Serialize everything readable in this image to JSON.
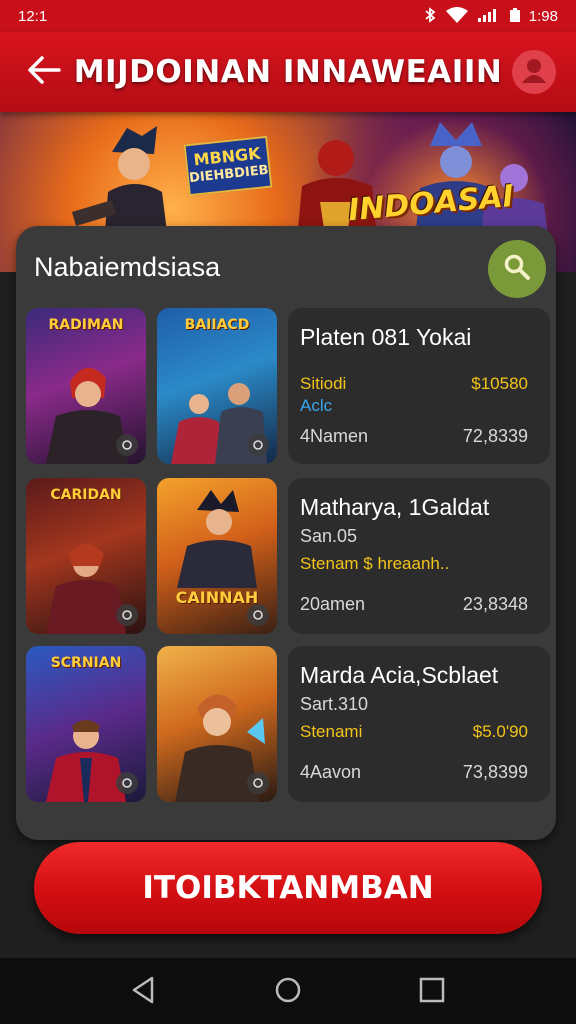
{
  "status_bar": {
    "time": "12:1",
    "battery_text": "1:98"
  },
  "app_bar": {
    "title": "MIJDOINAN INNAWEAIIN",
    "back_icon": "arrow-left-icon",
    "profile_icon": "user-avatar-icon"
  },
  "banner": {
    "logo_line1": "MBNGK",
    "logo_line2": "DIEHBDIEB",
    "headline": "INDOASAI"
  },
  "search": {
    "text": "Nabaiemdsiasa",
    "icon": "search-icon"
  },
  "games": [
    {
      "thumb1_title": "RADIMAN",
      "thumb2_title": "BAIIACD",
      "name": "Platen 081 Yokai",
      "sub": "",
      "label1": "Sitiodi",
      "label2": "Aclc",
      "price": "$10580",
      "meta_left": "4Namen",
      "meta_right": "72,8339"
    },
    {
      "thumb1_title": "CARIDAN",
      "thumb2_title": "CAINNAH",
      "name": "Matharya, 1Galdat",
      "sub": "San.05",
      "label1": "Stenam $ hreaanh..",
      "label2": "",
      "price": "",
      "meta_left": "20amen",
      "meta_right": "23,8348"
    },
    {
      "thumb1_title": "SCRNIAN",
      "thumb2_title": "",
      "name": "Marda Acia,Scblaet",
      "sub": "Sart.310",
      "label1": "Stenami",
      "label2": "",
      "price": "$5.0'90",
      "meta_left": "4Aavon",
      "meta_right": "73,8399"
    }
  ],
  "cta": {
    "label": "ITOIBKTANMBAN"
  },
  "colors": {
    "brand_red": "#c8101a",
    "panel": "#3a3a3a",
    "card": "#2c2c2c",
    "accent_gold": "#f2c318",
    "accent_blue": "#39a6f0",
    "search_green": "#7a9a3a"
  }
}
